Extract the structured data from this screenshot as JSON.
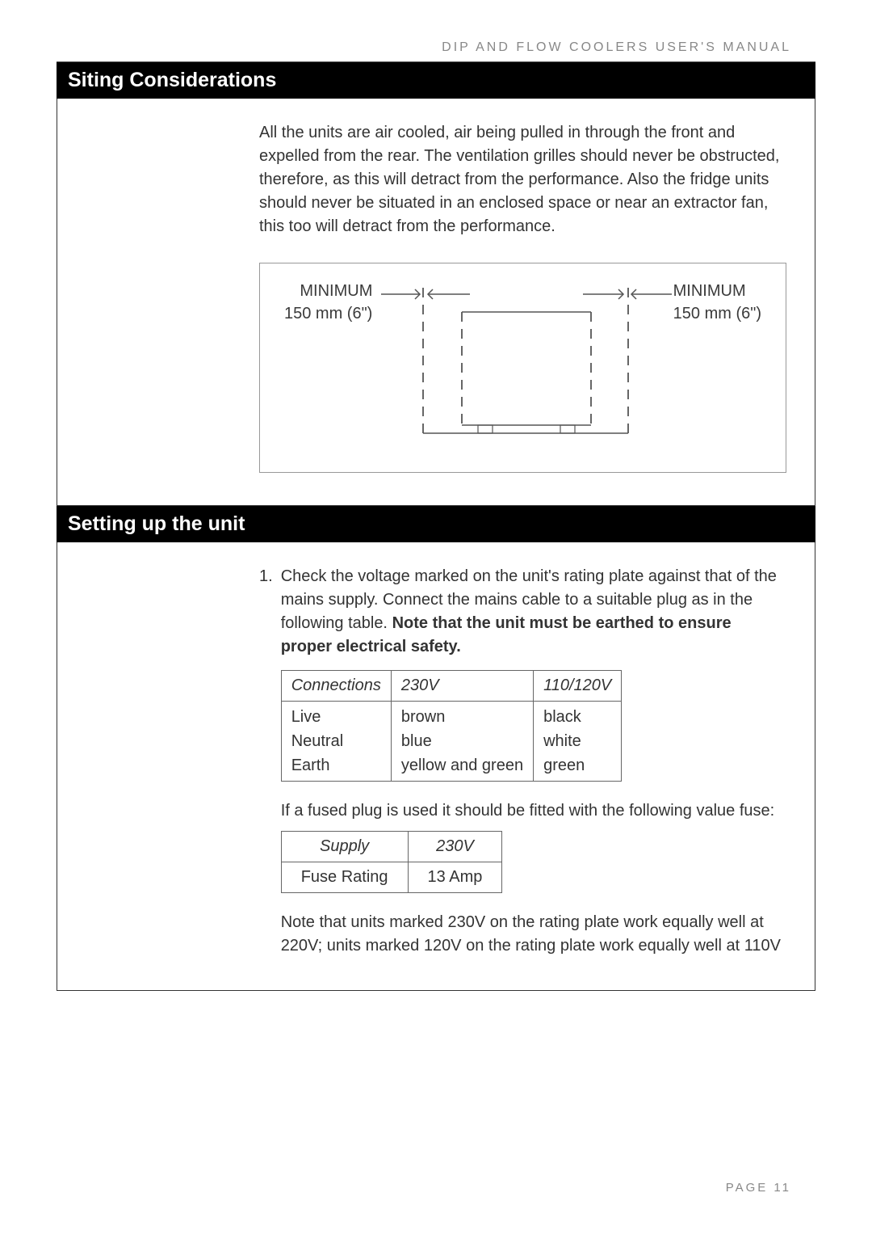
{
  "header": {
    "running_head": "DIP AND FLOW  COOLERS USER'S  MANUAL"
  },
  "section1": {
    "title": "Siting Considerations",
    "para": "All the units are air cooled, air being pulled in through the front and expelled from the rear.  The ventilation grilles should never be obstructed, therefore, as this will detract from the performance.  Also the fridge units should never be situated in an enclosed space or near an extractor fan, this too will detract from the performance.",
    "diag_left_l1": "MINIMUM",
    "diag_left_l2": "150 mm (6\")",
    "diag_right_l1": "MINIMUM",
    "diag_right_l2": "150 mm (6\")"
  },
  "section2": {
    "title": "Setting up the unit",
    "item1_num": "1.",
    "item1_text_a": "Check the voltage marked on the unit's rating plate against that of the mains supply. Connect the mains cable to a suitable plug as in the following table.  ",
    "item1_text_b": "Note that the unit must be earthed to ensure proper electrical safety.",
    "conn_h1": "Connections",
    "conn_h2": "230V",
    "conn_h3": "110/120V",
    "conn_c1a": "Live",
    "conn_c1b": "Neutral",
    "conn_c1c": "Earth",
    "conn_c2a": "brown",
    "conn_c2b": "blue",
    "conn_c2c": "yellow and green",
    "conn_c3a": "black",
    "conn_c3b": "white",
    "conn_c3c": "green",
    "fuse_intro": "If a fused plug is used it should be fitted with the following value fuse:",
    "fuse_h1": "Supply",
    "fuse_h2": "230V",
    "fuse_r1": "Fuse Rating",
    "fuse_r2": "13 Amp",
    "note": "Note that units marked 230V on the rating plate work equally well at 220V; units marked 120V on the rating plate work equally well at 110V"
  },
  "footer": {
    "page": "PAGE 11"
  }
}
